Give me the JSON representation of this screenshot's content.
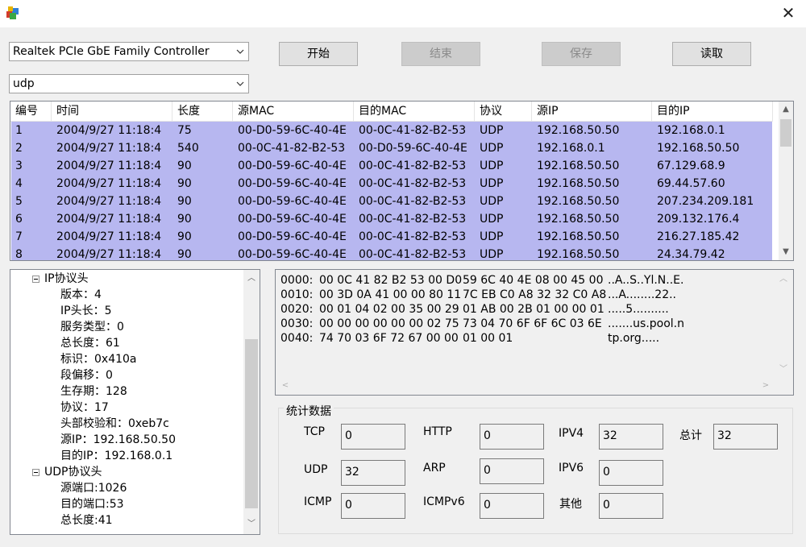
{
  "window": {
    "close_glyph": "✕"
  },
  "adapter_select": {
    "value": "Realtek PCIe GbE Family Controller"
  },
  "filter_select": {
    "value": "udp"
  },
  "buttons": {
    "start": "开始",
    "stop": "结束",
    "save": "保存",
    "read": "读取"
  },
  "packet_table": {
    "headers": [
      "编号",
      "时间",
      "长度",
      "源MAC",
      "目的MAC",
      "协议",
      "源IP",
      "目的IP"
    ],
    "rows": [
      [
        "1",
        "2004/9/27  11:18:4",
        "75",
        "00-D0-59-6C-40-4E",
        "00-0C-41-82-B2-53",
        "UDP",
        "192.168.50.50",
        "192.168.0.1"
      ],
      [
        "2",
        "2004/9/27  11:18:4",
        "540",
        "00-0C-41-82-B2-53",
        "00-D0-59-6C-40-4E",
        "UDP",
        "192.168.0.1",
        "192.168.50.50"
      ],
      [
        "3",
        "2004/9/27  11:18:4",
        "90",
        "00-D0-59-6C-40-4E",
        "00-0C-41-82-B2-53",
        "UDP",
        "192.168.50.50",
        "67.129.68.9"
      ],
      [
        "4",
        "2004/9/27  11:18:4",
        "90",
        "00-D0-59-6C-40-4E",
        "00-0C-41-82-B2-53",
        "UDP",
        "192.168.50.50",
        "69.44.57.60"
      ],
      [
        "5",
        "2004/9/27  11:18:4",
        "90",
        "00-D0-59-6C-40-4E",
        "00-0C-41-82-B2-53",
        "UDP",
        "192.168.50.50",
        "207.234.209.181"
      ],
      [
        "6",
        "2004/9/27  11:18:4",
        "90",
        "00-D0-59-6C-40-4E",
        "00-0C-41-82-B2-53",
        "UDP",
        "192.168.50.50",
        "209.132.176.4"
      ],
      [
        "7",
        "2004/9/27  11:18:4",
        "90",
        "00-D0-59-6C-40-4E",
        "00-0C-41-82-B2-53",
        "UDP",
        "192.168.50.50",
        "216.27.185.42"
      ],
      [
        "8",
        "2004/9/27  11:18:4",
        "90",
        "00-D0-59-6C-40-4E",
        "00-0C-41-82-B2-53",
        "UDP",
        "192.168.50.50",
        "24.34.79.42"
      ]
    ]
  },
  "tree": {
    "ip_header": "IP协议头",
    "ip_fields": [
      "版本：4",
      "IP头长：5",
      "服务类型：0",
      "总长度：61",
      "标识：0x410a",
      "段偏移：0",
      "生存期：128",
      "协议：17",
      "头部校验和：0xeb7c",
      "源IP：192.168.50.50",
      "目的IP：192.168.0.1"
    ],
    "udp_header": "UDP协议头",
    "udp_fields": [
      "源端口:1026",
      "目的端口:53",
      "总长度:41"
    ]
  },
  "hexdump": [
    {
      "offset": "0000:",
      "hex1": "00 0C 41 82 B2 53 00 D0",
      "hex2": "59 6C 40 4E 08 00 45 00",
      "ascii": "..A..S..Yl.N..E."
    },
    {
      "offset": "0010:",
      "hex1": "00 3D 0A 41 00 00 80 11",
      "hex2": "7C EB C0 A8 32 32 C0 A8",
      "ascii": "...A........22.."
    },
    {
      "offset": "0020:",
      "hex1": "00 01 04 02 00 35 00 29",
      "hex2": "01 AB 00 2B 01 00 00 01",
      "ascii": ".....5.........."
    },
    {
      "offset": "0030:",
      "hex1": "00 00 00 00 00 00 02 75",
      "hex2": "73 04 70 6F 6F 6C 03 6E",
      "ascii": ".......us.pool.n"
    },
    {
      "offset": "0040:",
      "hex1": "74 70 03 6F 72 67 00 00",
      "hex2": "01 00 01",
      "ascii": "tp.org....."
    }
  ],
  "stats": {
    "title": "统计数据",
    "tcp_label": "TCP",
    "tcp_value": "0",
    "http_label": "HTTP",
    "http_value": "0",
    "ipv4_label": "IPV4",
    "ipv4_value": "32",
    "total_label": "总计",
    "total_value": "32",
    "udp_label": "UDP",
    "udp_value": "32",
    "arp_label": "ARP",
    "arp_value": "0",
    "ipv6_label": "IPV6",
    "ipv6_value": "0",
    "icmp_label": "ICMP",
    "icmp_value": "0",
    "icmpv6_label": "ICMPv6",
    "icmpv6_value": "0",
    "other_label": "其他",
    "other_value": "0"
  }
}
